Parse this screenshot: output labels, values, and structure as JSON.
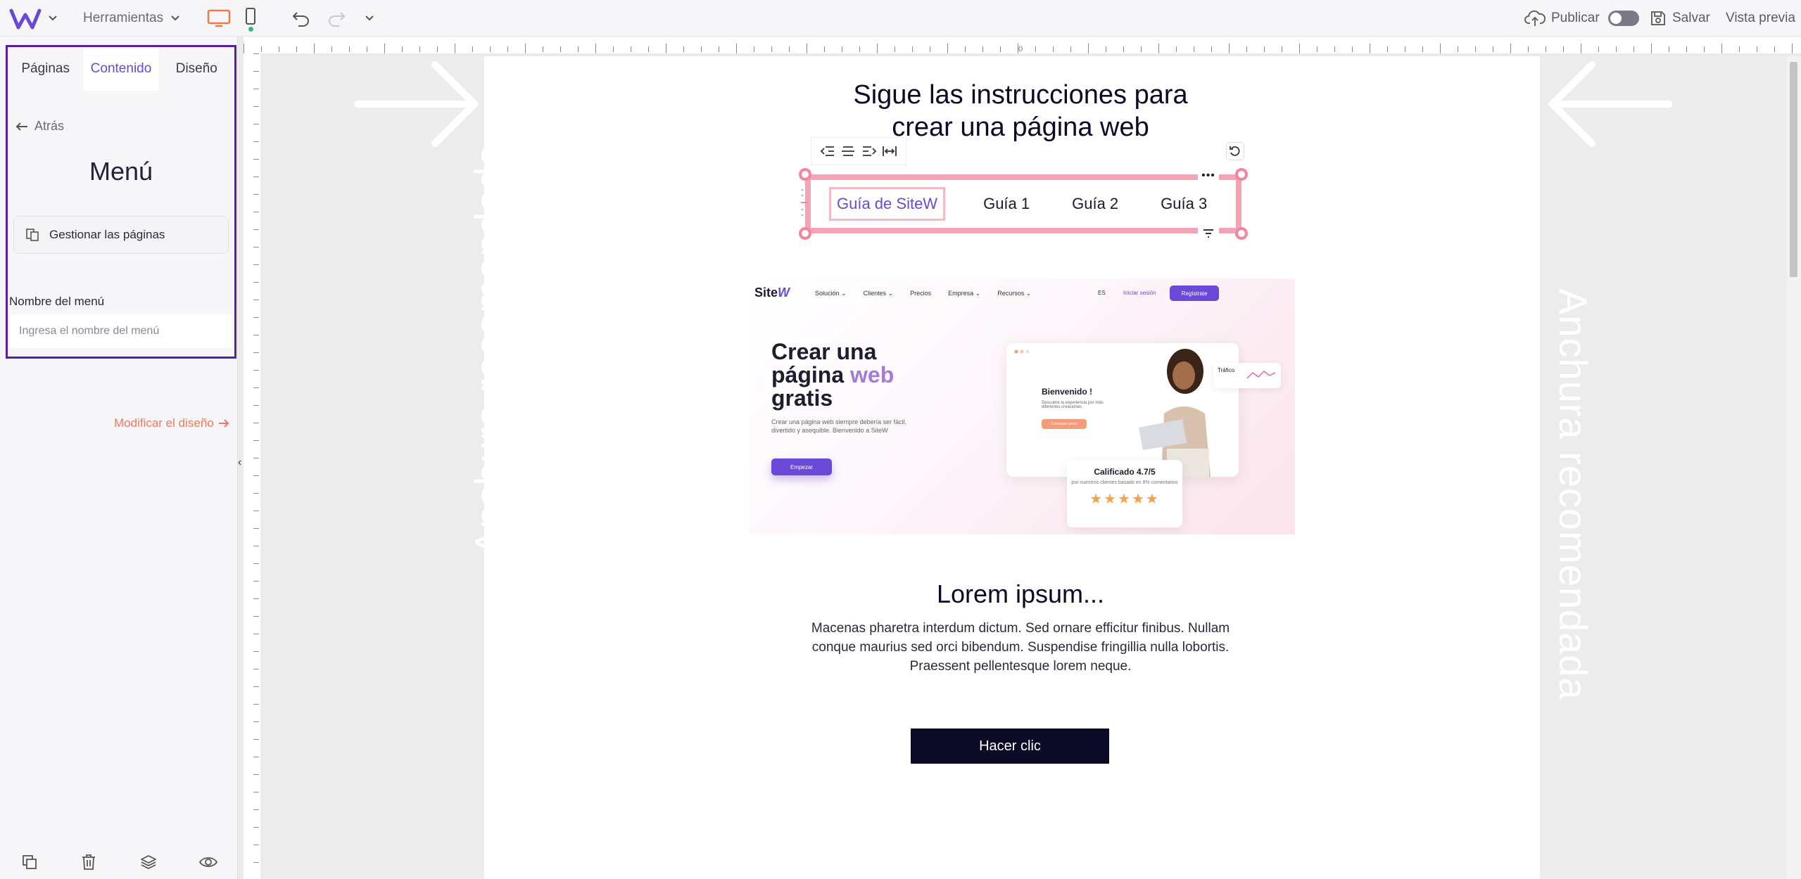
{
  "topbar": {
    "tools_label": "Herramientas",
    "publish_label": "Publicar",
    "save_label": "Salvar",
    "preview_label": "Vista previa"
  },
  "panel": {
    "tabs": [
      "Páginas",
      "Contenido",
      "Diseño"
    ],
    "active_tab": "Contenido",
    "back_label": "Atrás",
    "title": "Menú",
    "manage_pages_label": "Gestionar las páginas",
    "menu_name_label": "Nombre del menú",
    "menu_name_placeholder": "Ingresa el nombre del menú",
    "menu_name_value": "",
    "modify_design_label": "Modificar el diseño"
  },
  "ruler": {
    "zero_label": "0"
  },
  "canvas": {
    "recommended_width_label": "Anchura recomendada",
    "headline_line1": "Sigue las instrucciones para",
    "headline_line2": "crear una página web",
    "menu_items": [
      "Guía de SiteW",
      "Guía 1",
      "Guía 2",
      "Guía 3"
    ],
    "lorem_title": "Lorem ipsum...",
    "lorem_text": "Macenas pharetra interdum dictum. Sed ornare efficitur finibus. Nullam conque maurius sed orci bibendum. Suspendise fringillia nulla lobortis. Praessent pellentesque lorem neque.",
    "cta_label": "Hacer clic"
  },
  "mockup": {
    "logo_a": "Site",
    "logo_b": "W",
    "nav": [
      "Solución ⌄",
      "Clientes ⌄",
      "Precios",
      "Empresa ⌄",
      "Recursos ⌄"
    ],
    "lang": "ES",
    "login": "Iniciar sesión",
    "register": "Regístrate",
    "hero_a": "Crear una página ",
    "hero_b": "web",
    "hero_c": " gratis",
    "hero_sub": "Crear una página web siempre debería ser fácil, divertido y asequible. Bienvenido a SiteW",
    "cta": "Empezar",
    "welcome": "Bienvenido !",
    "welcome_sub": "Descubre la experiencia por más diferentes creaciones",
    "card_btn": "Comenzar ahora",
    "traffic": "Tráfico",
    "rating_title": "Calificado 4.7/5",
    "rating_sub": "por nuestros clientes basado en 8% comentarios",
    "stars": "★★★★★"
  },
  "colors": {
    "accent": "#6a49d9",
    "panel_border": "#5b1f9b",
    "selection": "#f5a3b7",
    "link_orange": "#f07860",
    "dark_button": "#0b0a26",
    "desktop_icon": "#f07848",
    "online_dot": "#2db889"
  },
  "icons": {
    "logo": "w-logo",
    "desktop": "desktop-icon",
    "mobile": "mobile-icon",
    "undo": "undo-icon",
    "redo": "redo-icon",
    "publish": "cloud-upload-icon",
    "save": "save-icon",
    "bottom": [
      "duplicate-icon",
      "trash-icon",
      "layers-icon",
      "eye-icon"
    ]
  }
}
